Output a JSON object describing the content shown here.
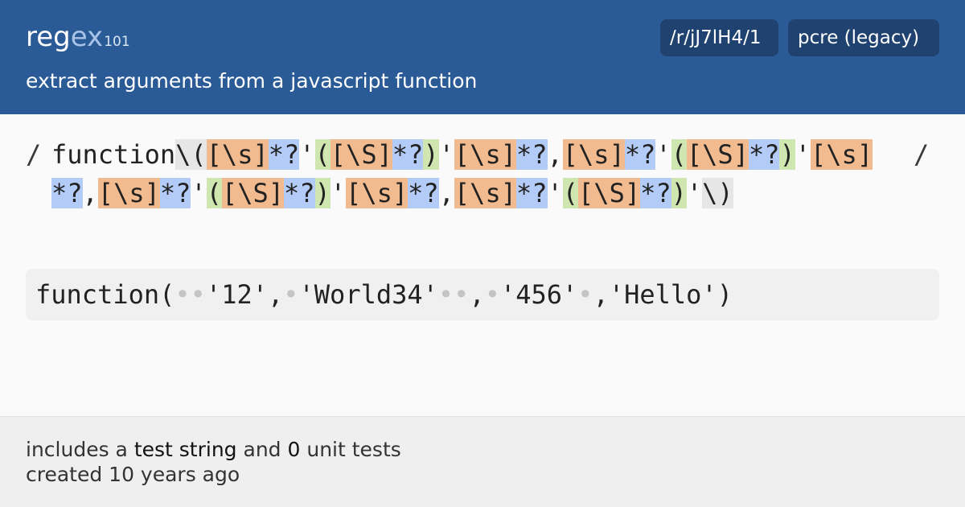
{
  "header": {
    "logo": {
      "part1": "reg",
      "part2": "ex",
      "part3": "101"
    },
    "description": "extract arguments from a javascript function",
    "permalink": "/r/jJ7lH4/1",
    "flavor": "pcre (legacy)"
  },
  "regex": {
    "delimiter_left": "/",
    "delimiter_right": "/",
    "tokens": [
      {
        "t": "function",
        "k": "lit"
      },
      {
        "t": "\\(",
        "k": "esc"
      },
      {
        "t": "[\\s]",
        "k": "cls"
      },
      {
        "t": "*?",
        "k": "quant"
      },
      {
        "t": "'",
        "k": "lit"
      },
      {
        "t": "(",
        "k": "grp"
      },
      {
        "t": "[\\S]",
        "k": "cls"
      },
      {
        "t": "*?",
        "k": "quant"
      },
      {
        "t": ")",
        "k": "grp"
      },
      {
        "t": "'",
        "k": "lit"
      },
      {
        "t": "[\\s]",
        "k": "cls"
      },
      {
        "t": "*?",
        "k": "quant"
      },
      {
        "t": ",",
        "k": "lit"
      },
      {
        "t": "[\\s]",
        "k": "cls"
      },
      {
        "t": "*?",
        "k": "quant"
      },
      {
        "t": "'",
        "k": "lit"
      },
      {
        "t": "(",
        "k": "grp"
      },
      {
        "t": "[\\S]",
        "k": "cls"
      },
      {
        "t": "*?",
        "k": "quant"
      },
      {
        "t": ")",
        "k": "grp"
      },
      {
        "t": "'",
        "k": "lit"
      },
      {
        "t": "[\\s]",
        "k": "cls"
      },
      {
        "t": "*?",
        "k": "quant"
      },
      {
        "t": ",",
        "k": "lit"
      },
      {
        "t": "[\\s]",
        "k": "cls"
      },
      {
        "t": "*?",
        "k": "quant"
      },
      {
        "t": "'",
        "k": "lit"
      },
      {
        "t": "(",
        "k": "grp"
      },
      {
        "t": "[\\S]",
        "k": "cls"
      },
      {
        "t": "*?",
        "k": "quant"
      },
      {
        "t": ")",
        "k": "grp"
      },
      {
        "t": "'",
        "k": "lit"
      },
      {
        "t": "[\\s]",
        "k": "cls"
      },
      {
        "t": "*?",
        "k": "quant"
      },
      {
        "t": ",",
        "k": "lit"
      },
      {
        "t": "[\\s]",
        "k": "cls"
      },
      {
        "t": "*?",
        "k": "quant"
      },
      {
        "t": "'",
        "k": "lit"
      },
      {
        "t": "(",
        "k": "grp"
      },
      {
        "t": "[\\S]",
        "k": "cls"
      },
      {
        "t": "*?",
        "k": "quant"
      },
      {
        "t": ")",
        "k": "grp"
      },
      {
        "t": "'",
        "k": "lit"
      },
      {
        "t": "\\)",
        "k": "esc"
      }
    ]
  },
  "test_string": {
    "segments": [
      {
        "t": "function(",
        "k": "text"
      },
      {
        "t": "••",
        "k": "ws"
      },
      {
        "t": "'12',",
        "k": "text"
      },
      {
        "t": "•",
        "k": "ws"
      },
      {
        "t": "'World34'",
        "k": "text"
      },
      {
        "t": "••",
        "k": "ws"
      },
      {
        "t": ",",
        "k": "text"
      },
      {
        "t": "•",
        "k": "ws"
      },
      {
        "t": "'456'",
        "k": "text"
      },
      {
        "t": "•",
        "k": "ws"
      },
      {
        "t": ",'Hello')",
        "k": "text"
      }
    ]
  },
  "footer": {
    "line1_prefix": "includes a ",
    "line1_bold": "test string",
    "line1_mid": " and ",
    "line1_count": "0",
    "line1_suffix": " unit tests",
    "line2": "created 10 years ago"
  },
  "colors": {
    "header_bg": "#2a5b97",
    "badge_bg": "#1f4270",
    "char_class": "#f2bb8f",
    "quantifier": "#b3ccf7",
    "group": "#cfe6b0",
    "escape": "#e6e6e6"
  }
}
